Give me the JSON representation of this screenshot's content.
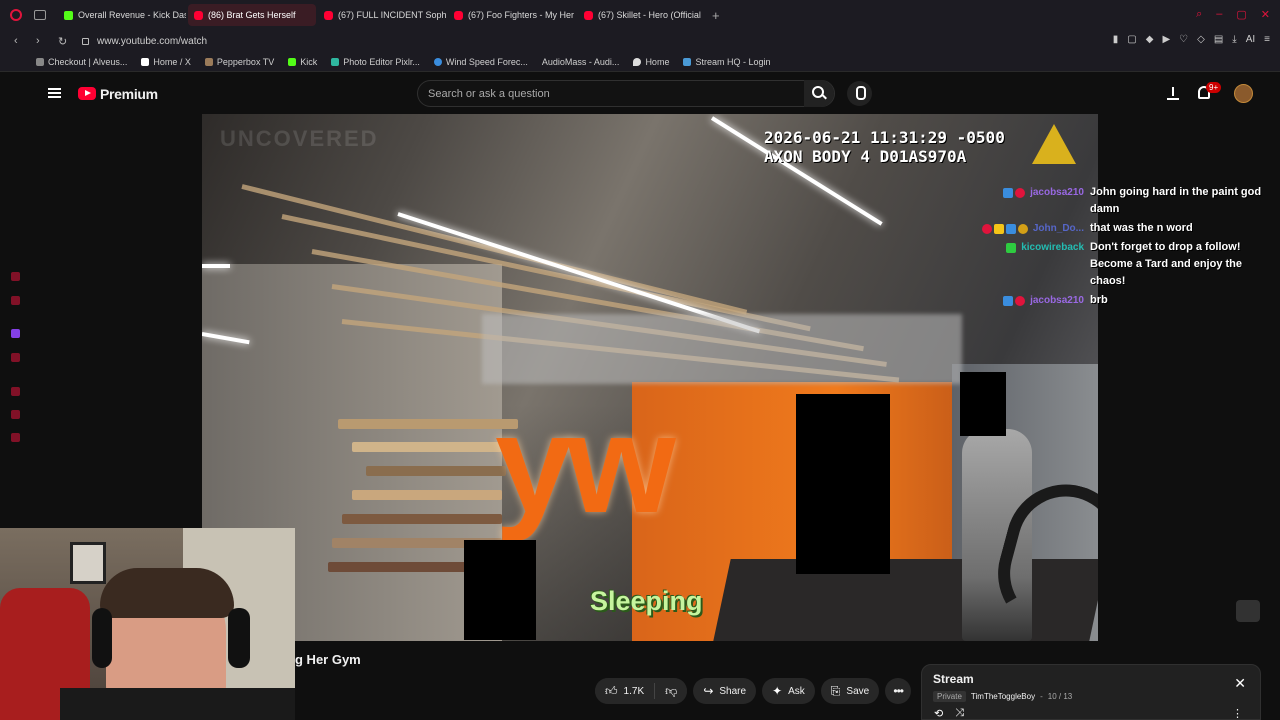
{
  "browser": {
    "tabs": [
      {
        "label": "Overall Revenue - Kick Das",
        "icon": "kick",
        "active": false
      },
      {
        "label": "(86) Brat Gets Herself",
        "icon": "youtube",
        "active": true
      },
      {
        "label": "(67) FULL INCIDENT Soph",
        "icon": "youtube",
        "active": false
      },
      {
        "label": "(67) Foo Fighters - My Her",
        "icon": "youtube",
        "active": false
      },
      {
        "label": "(67) Skillet - Hero (Official",
        "icon": "youtube",
        "active": false
      }
    ],
    "new_tab": "+",
    "url": "www.youtube.com/watch",
    "ai_label": "AI",
    "bookmarks": [
      {
        "label": "Checkout | Alveus..."
      },
      {
        "label": "Home / X"
      },
      {
        "label": "Pepperbox TV"
      },
      {
        "label": "Kick"
      },
      {
        "label": "Photo Editor Pixlr..."
      },
      {
        "label": "Wind Speed Forec..."
      },
      {
        "label": "AudioMass - Audi..."
      },
      {
        "label": "Home"
      },
      {
        "label": "Stream HQ - Login"
      }
    ]
  },
  "youtube": {
    "brand": "Premium",
    "search_placeholder": "Search or ask a question",
    "notifications": "9+"
  },
  "video": {
    "timestamp_line1": "2026-06-21 11:31:29 -0500",
    "timestamp_line2": "AXON BODY 4 D01AS970A",
    "watermark": "UNCOVERED",
    "caption": "Sleeping",
    "title": "g Her Gym"
  },
  "chat": [
    {
      "user": "jacobsa210",
      "user_color": "#a970ff",
      "message": "John going hard in the paint god damn"
    },
    {
      "user": "John_Do...",
      "user_color": "#5b6ee1",
      "message": "that was the n word"
    },
    {
      "user": "kicowireback",
      "user_color": "#1fd3c6",
      "message": "Don't forget to drop a follow! Become a Tard and enjoy the chaos!"
    },
    {
      "user": "jacobsa210",
      "user_color": "#a970ff",
      "message": "brb"
    }
  ],
  "actions": {
    "likes": "1.7K",
    "share": "Share",
    "ask": "Ask",
    "save": "Save"
  },
  "playlist": {
    "title": "Stream",
    "privacy": "Private",
    "owner": "TimTheToggleBoy",
    "position": "10 / 13"
  }
}
